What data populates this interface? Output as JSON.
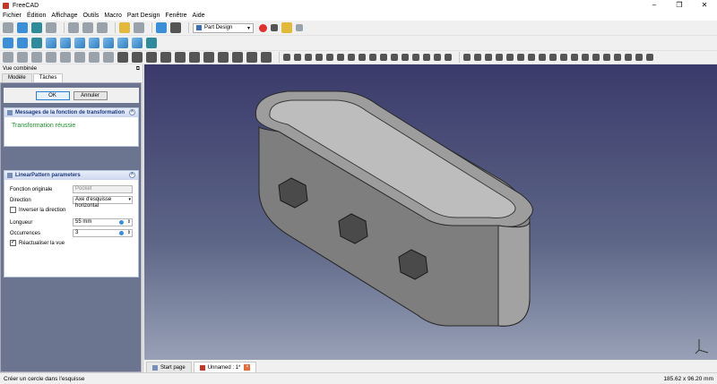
{
  "window": {
    "title": "FreeCAD",
    "controls": [
      "–",
      "❐",
      "✕"
    ]
  },
  "menu": [
    "Fichier",
    "Édition",
    "Affichage",
    "Outils",
    "Macro",
    "Part Design",
    "Fenêtre",
    "Aide"
  ],
  "workbench": {
    "selected": "Part Design"
  },
  "combo": {
    "title": "Vue combinée",
    "tabs": [
      "Modèle",
      "Tâches"
    ],
    "ok_label": "OK",
    "cancel_label": "Annuler"
  },
  "messages_panel": {
    "title": "Messages de la fonction de transformation",
    "text": "Transformation réussie"
  },
  "pattern_panel": {
    "title": "LinearPattern parameters",
    "original_label": "Fonction originale",
    "original_value": "Pocket",
    "direction_label": "Direction",
    "direction_value": "Axe d'esquisse horizontal",
    "reverse_label": "Inverser la direction",
    "length_label": "Longueur",
    "length_value": "55 mm",
    "occurrences_label": "Occurrences",
    "occurrences_value": "3",
    "update_label": "Réactualiser la vue"
  },
  "doc_tabs": [
    {
      "label": "Start page"
    },
    {
      "label": "Unnamed : 1*"
    }
  ],
  "status": {
    "message": "Créer un cercle dans l'esquisse",
    "dimensions": "185.62 x 96.20 mm"
  },
  "colors": {
    "viewport_top": "#3a3a6a",
    "viewport_bottom": "#98a1b6",
    "success": "#1f8f2e",
    "model": "#8c8c8c"
  }
}
